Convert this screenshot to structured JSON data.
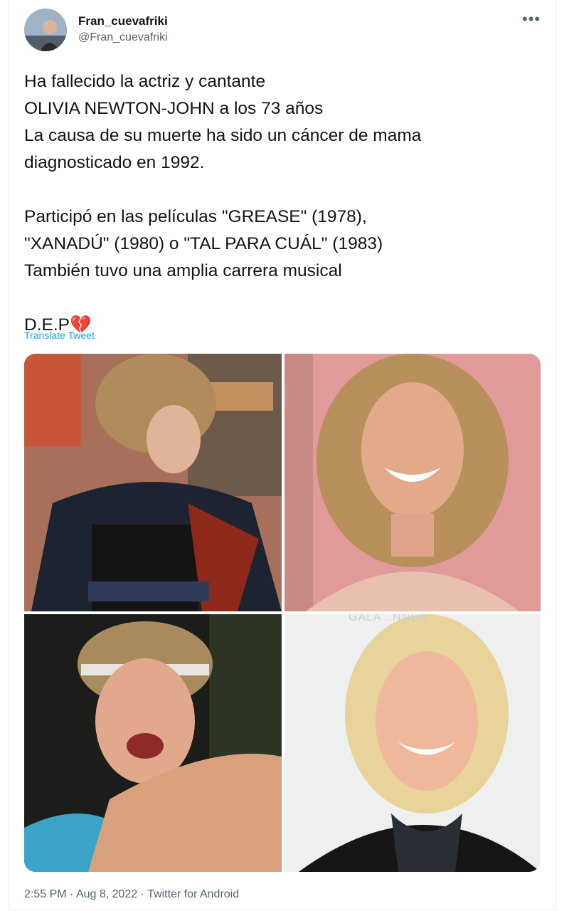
{
  "author": {
    "display_name": "Fran_cuevafriki",
    "handle": "@Fran_cuevafriki"
  },
  "more_icon": "•••",
  "tweet": {
    "text": "Ha fallecido la actriz y cantante\nOLIVIA NEWTON-JOHN a los 73 años\nLa causa de su muerte ha sido un cáncer de mama\ndiagnosticado en 1992.\n\nParticipó en las películas \"GREASE\" (1978),\n\"XANADÚ\" (1980) o \"TAL PARA CUÁL\" (1983)\nTambién tuvo una amplia carrera musical\n\nD.E.P💔",
    "translate_label": "Translate Tweet"
  },
  "media": {
    "photos": [
      {
        "icon": "photo-grease-leather-jacket"
      },
      {
        "icon": "photo-feathered-hair-portrait"
      },
      {
        "icon": "photo-headband-portrait"
      },
      {
        "icon": "photo-blonde-smiling-portrait"
      }
    ],
    "watermark_text": "GALA ..NNER"
  },
  "footer": {
    "time": "2:55 PM",
    "separator": " · ",
    "date": "Aug 8, 2022",
    "source": "Twitter for Android"
  },
  "colors": {
    "link": "#1d9bf0",
    "secondary_text": "#536471",
    "text": "#0f1419"
  }
}
